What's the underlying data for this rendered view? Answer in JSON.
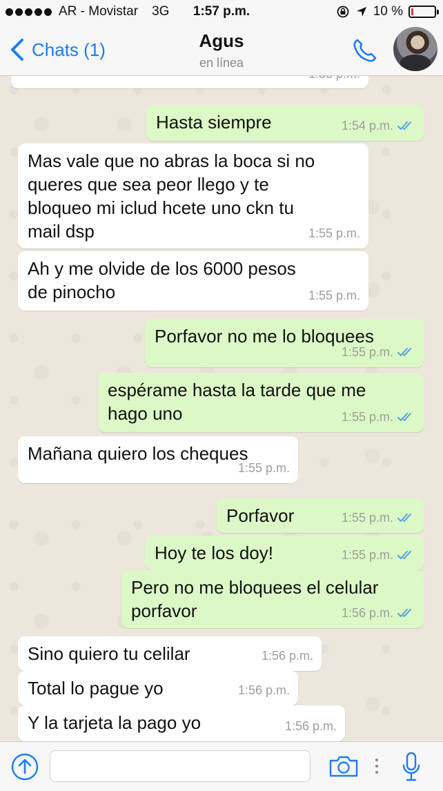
{
  "status_bar": {
    "carrier": "AR - Movistar",
    "network": "3G",
    "time": "1:57 p.m.",
    "battery": "10 %",
    "battery_level_percent": 10
  },
  "header": {
    "back_label": "Chats (1)",
    "contact_name": "Agus",
    "contact_status": "en línea",
    "accent_color": "#1b7cf5"
  },
  "messages": [
    {
      "direction": "in",
      "text": "",
      "time": "1:53 p.m.",
      "partial": true
    },
    {
      "direction": "out",
      "text": "Hasta siempre",
      "time": "1:54 p.m.",
      "read": true
    },
    {
      "direction": "in",
      "text": "Mas vale que no abras la boca si no\nqueres que sea peor llego y te\nbloqueo mi iclud hcete uno ckn tu\nmail dsp",
      "time": "1:55 p.m."
    },
    {
      "direction": "in",
      "text": "Ah y me olvide de los 6000 pesos\nde pinocho",
      "time": "1:55 p.m."
    },
    {
      "direction": "out",
      "text": "Porfavor no me lo bloquees",
      "time": "1:55 p.m.",
      "read": true
    },
    {
      "direction": "out",
      "text": "espérame hasta la tarde que me\nhago uno",
      "time": "1:55 p.m.",
      "read": true
    },
    {
      "direction": "in",
      "text": "Mañana quiero los cheques",
      "time": "1:55 p.m."
    },
    {
      "direction": "out",
      "text": "Porfavor",
      "time": "1:55 p.m.",
      "read": true
    },
    {
      "direction": "out",
      "text": "Hoy te los doy!",
      "time": "1:55 p.m.",
      "read": true
    },
    {
      "direction": "out",
      "text": "Pero no me bloquees el celular\nporfavor",
      "time": "1:56 p.m.",
      "read": true
    },
    {
      "direction": "in",
      "text": "Sino quiero tu celilar",
      "time": "1:56 p.m."
    },
    {
      "direction": "in",
      "text": "Total lo pague yo",
      "time": "1:56 p.m."
    },
    {
      "direction": "in",
      "text": "Y la tarjeta la pago yo",
      "time": "1:56 p.m."
    }
  ],
  "input": {
    "placeholder": ""
  },
  "colors": {
    "incoming_bubble": "#ffffff",
    "outgoing_bubble": "#dcf8c6",
    "read_ticks": "#4fa3e0",
    "chat_background": "#ece6dc"
  },
  "icons": [
    "back-chevron-icon",
    "phone-icon",
    "avatar",
    "attach-arrow-icon",
    "camera-icon",
    "more-dots-icon",
    "microphone-icon",
    "double-check-icon"
  ]
}
